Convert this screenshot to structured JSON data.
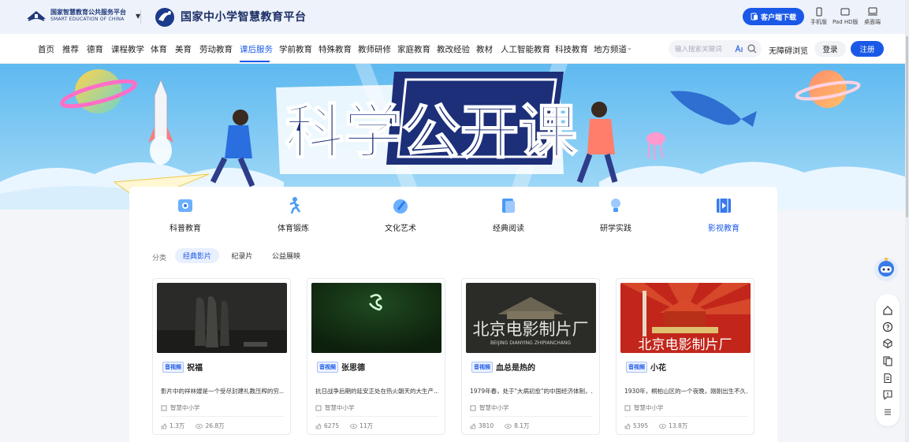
{
  "header": {
    "platform_logo_cn": "国家智慧教育公共服务平台",
    "platform_logo_en": "SMART EDUCATION OF CHINA",
    "site_title": "国家中小学智慧教育平台",
    "download_button": "客户端下载",
    "devices": [
      {
        "label": "手机版",
        "icon": "mobile-icon"
      },
      {
        "label": "Pad HD版",
        "icon": "tablet-icon"
      },
      {
        "label": "桌面端",
        "icon": "desktop-icon"
      }
    ]
  },
  "nav": {
    "items": [
      "首页",
      "推荐",
      "德育",
      "课程教学",
      "体育",
      "美育",
      "劳动教育",
      "课后服务",
      "学前教育",
      "特殊教育",
      "教师研修",
      "家庭教育",
      "教改经验",
      "教材",
      "人工智能教育",
      "科技教育",
      "地方频道"
    ],
    "active": "课后服务",
    "search_placeholder": "输入搜索关键词",
    "accessibility": "无障碍浏览",
    "login": "登录",
    "register": "注册"
  },
  "banner": {
    "title": "科学公开课"
  },
  "categories": [
    {
      "label": "科普教育",
      "icon": "science-icon"
    },
    {
      "label": "体育锻炼",
      "icon": "running-icon"
    },
    {
      "label": "文化艺术",
      "icon": "art-icon"
    },
    {
      "label": "经典阅读",
      "icon": "book-icon"
    },
    {
      "label": "研学实践",
      "icon": "lightbulb-icon"
    },
    {
      "label": "影视教育",
      "icon": "film-icon"
    }
  ],
  "active_category": "影视教育",
  "filter": {
    "label": "分类",
    "chips": [
      "经典影片",
      "纪录片",
      "公益展映"
    ],
    "active": "经典影片"
  },
  "cards": [
    {
      "tag": "音视频",
      "title": "祝福",
      "desc": "影片中的祥林嫂是一个受尽封建礼教压榨的穷...",
      "source": "智慧中小学",
      "likes": "1.3万",
      "views": "26.8万"
    },
    {
      "tag": "音视频",
      "title": "张思德",
      "desc": "抗日战争后期的延安正处在热火朝天的大生产...",
      "source": "智慧中小学",
      "likes": "6275",
      "views": "11万"
    },
    {
      "tag": "音视频",
      "title": "血总是热的",
      "desc": "1979年春，处于\"大病初愈\"的中国经济体制，...",
      "source": "智慧中小学",
      "likes": "3810",
      "views": "8.1万",
      "thumb_text": "北京电影制片厂",
      "thumb_sub": "BEIJING DIANYING ZHIPIANCHANG"
    },
    {
      "tag": "音视频",
      "title": "小花",
      "desc": "1930年，桐柏山区的一个夜晚，刚刚出生不久...",
      "source": "智慧中小学",
      "likes": "5395",
      "views": "13.8万",
      "thumb_text": "北京电影制片厂"
    }
  ],
  "colors": {
    "accent": "#1a59e8",
    "nav_bg": "#ffffff",
    "page_bg": "#f3f5f9"
  }
}
